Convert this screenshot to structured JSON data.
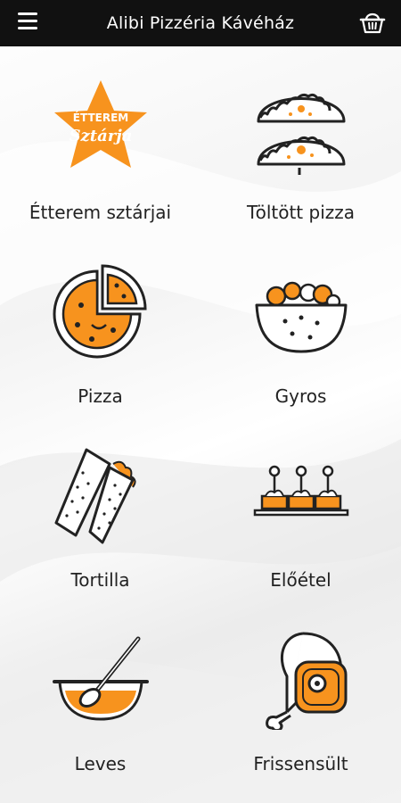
{
  "header": {
    "title": "Alibi Pizzéria Kávéház",
    "menu_icon": "hamburger-menu-icon",
    "basket_icon": "basket-icon"
  },
  "colors": {
    "accent": "#f7931e",
    "header_bg": "#111111",
    "stroke": "#222222"
  },
  "categories": [
    {
      "label": "Étterem sztárjai",
      "icon": "star-badge-icon",
      "badge_text_top": "ÉTTEREM",
      "badge_text_bottom": "Sztárja"
    },
    {
      "label": "Töltött pizza",
      "icon": "calzone-icon"
    },
    {
      "label": "Pizza",
      "icon": "pizza-icon"
    },
    {
      "label": "Gyros",
      "icon": "gyros-bowl-icon"
    },
    {
      "label": "Tortilla",
      "icon": "tortilla-wrap-icon"
    },
    {
      "label": "Előétel",
      "icon": "appetizer-skewers-icon"
    },
    {
      "label": "Leves",
      "icon": "soup-bowl-icon"
    },
    {
      "label": "Frissensült",
      "icon": "meat-leg-icon"
    }
  ]
}
